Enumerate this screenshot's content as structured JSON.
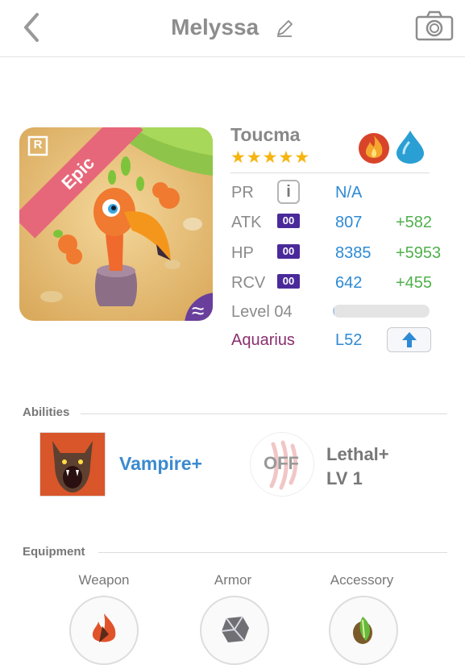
{
  "header": {
    "title": "Melyssa",
    "back_icon": "chevron-left-icon",
    "edit_icon": "pencil-icon",
    "camera_icon": "camera-icon"
  },
  "monster": {
    "name": "Toucma",
    "rarity": "Epic",
    "rarity_badge": "R",
    "stars": "★★★★★",
    "elements": [
      "fire-element-icon",
      "water-element-icon"
    ],
    "element_badge": "≈"
  },
  "stats": {
    "pr": {
      "label": "PR",
      "value": "N/A"
    },
    "atk": {
      "label": "ATK",
      "badge": "00",
      "value": "807",
      "bonus": "+582"
    },
    "hp": {
      "label": "HP",
      "badge": "00",
      "value": "8385",
      "bonus": "+5953"
    },
    "rcv": {
      "label": "RCV",
      "badge": "00",
      "value": "642",
      "bonus": "+455"
    },
    "level": {
      "label": "Level 04",
      "progress": 0.02
    },
    "sign": {
      "label": "Aquarius",
      "value": "L52"
    }
  },
  "abilities": {
    "heading": "Abilities",
    "primary": {
      "label": "Vampire+"
    },
    "secondary": {
      "state": "OFF",
      "name": "Lethal+",
      "level": "LV 1"
    }
  },
  "equipment": {
    "heading": "Equipment",
    "slots": [
      "Weapon",
      "Armor",
      "Accessory"
    ]
  },
  "colors": {
    "accent": "#2e8ad4",
    "bonus": "#4fb04b",
    "epic": "#e7677a",
    "badge": "#4a2a9a",
    "sign": "#8b2f6e"
  }
}
